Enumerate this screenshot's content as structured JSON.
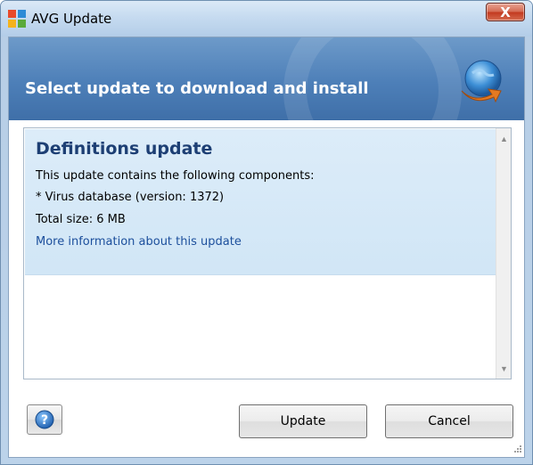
{
  "window": {
    "title": "AVG Update",
    "close_glyph": "X"
  },
  "banner": {
    "title": "Select update to download and install",
    "icon": "globe-update-icon"
  },
  "update_item": {
    "title": "Definitions update",
    "description": "This update contains the following components:",
    "component": "* Virus database (version: 1372)",
    "total_size": "Total size: 6 MB",
    "more_info_link": "More information about this update"
  },
  "buttons": {
    "help_glyph": "?",
    "update_label": "Update",
    "cancel_label": "Cancel"
  },
  "colors": {
    "banner": "#4d7fb8",
    "item_bg": "#d1e6f6",
    "title_text": "#1d3f74",
    "link": "#1c4f9c"
  }
}
